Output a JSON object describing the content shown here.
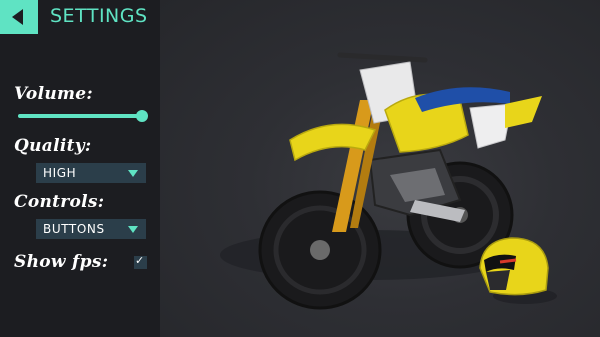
{
  "header": {
    "title": "SETTINGS",
    "back_icon": "back-arrow-icon"
  },
  "settings": {
    "volume_label": "Volume:",
    "volume_level": 1.0,
    "quality_label": "Quality:",
    "quality_value": "HIGH",
    "controls_label": "Controls:",
    "controls_value": "BUTTONS",
    "show_fps_label": "Show fps:",
    "show_fps_checked": true,
    "checkmark": "✓"
  },
  "colors": {
    "accent": "#5fe3c3",
    "panel": "#1c1d21",
    "dropdown_bg": "#2b3e4a",
    "bike_yellow": "#e8d51a",
    "seat_blue": "#1f4fa8"
  },
  "scene": {
    "vehicle": "dirt-bike",
    "accessory": "helmet"
  }
}
